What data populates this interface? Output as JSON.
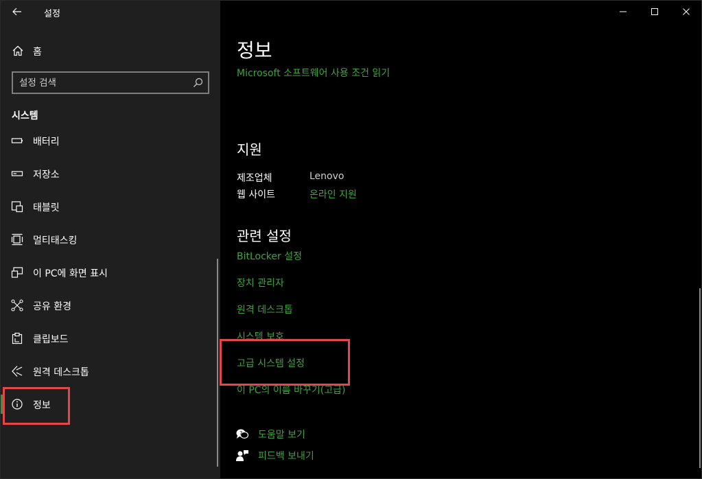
{
  "app": {
    "title": "설정"
  },
  "sidebar": {
    "home_label": "홈",
    "search_placeholder": "설정 검색",
    "section_title": "시스템",
    "items": [
      {
        "label": "배터리",
        "icon": "battery-icon"
      },
      {
        "label": "저장소",
        "icon": "storage-icon"
      },
      {
        "label": "태블릿",
        "icon": "tablet-icon"
      },
      {
        "label": "멀티태스킹",
        "icon": "multitasking-icon"
      },
      {
        "label": "이 PC에 화면 표시",
        "icon": "project-icon"
      },
      {
        "label": "공유 환경",
        "icon": "shared-experiences-icon"
      },
      {
        "label": "클립보드",
        "icon": "clipboard-icon"
      },
      {
        "label": "원격 데스크톱",
        "icon": "remote-desktop-icon"
      },
      {
        "label": "정보",
        "icon": "info-icon",
        "selected": true
      }
    ]
  },
  "main": {
    "title": "정보",
    "ms_terms_link": "Microsoft 소프트웨어 사용 조건 읽기",
    "support": {
      "heading": "지원",
      "manufacturer_label": "제조업체",
      "manufacturer_value": "Lenovo",
      "website_label": "웹 사이트",
      "website_link": "온라인 지원"
    },
    "related": {
      "heading": "관련 설정",
      "links": [
        "BitLocker 설정",
        "장치 관리자",
        "원격 데스크톱",
        "시스템 보호",
        "고급 시스템 설정",
        "이 PC의 이름 바꾸기(고급)"
      ]
    },
    "help": {
      "get_help": "도움말 보기",
      "feedback": "피드백 보내기"
    }
  },
  "colors": {
    "accent": "#2e9c33",
    "link": "#3fa33f",
    "highlight": "#e5464b",
    "sidebar_bg": "#1f1f1f",
    "main_bg": "#000000"
  }
}
